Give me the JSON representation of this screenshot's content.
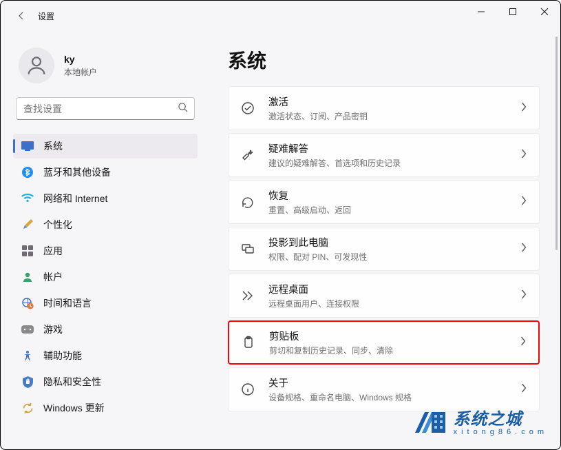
{
  "window": {
    "title": "设置"
  },
  "profile": {
    "name": "ky",
    "subtitle": "本地帐户"
  },
  "search": {
    "placeholder": "查找设置"
  },
  "nav": {
    "items": [
      {
        "label": "系统"
      },
      {
        "label": "蓝牙和其他设备"
      },
      {
        "label": "网络和 Internet"
      },
      {
        "label": "个性化"
      },
      {
        "label": "应用"
      },
      {
        "label": "帐户"
      },
      {
        "label": "时间和语言"
      },
      {
        "label": "游戏"
      },
      {
        "label": "辅助功能"
      },
      {
        "label": "隐私和安全性"
      },
      {
        "label": "Windows 更新"
      }
    ]
  },
  "page": {
    "title": "系统"
  },
  "cards": [
    {
      "title": "激活",
      "sub": "激活状态、订阅、产品密钥"
    },
    {
      "title": "疑难解答",
      "sub": "建议的疑难解答、首选项和历史记录"
    },
    {
      "title": "恢复",
      "sub": "重置、高级启动、返回"
    },
    {
      "title": "投影到此电脑",
      "sub": "权限、配对 PIN、可发现性"
    },
    {
      "title": "远程桌面",
      "sub": "远程桌面用户、连接权限"
    },
    {
      "title": "剪贴板",
      "sub": "剪切和复制历史记录、同步、清除"
    },
    {
      "title": "关于",
      "sub": "设备规格、重命名电脑、Windows 规格"
    }
  ],
  "watermark": {
    "line1": "系统之城",
    "line2": "xitong86.com"
  }
}
